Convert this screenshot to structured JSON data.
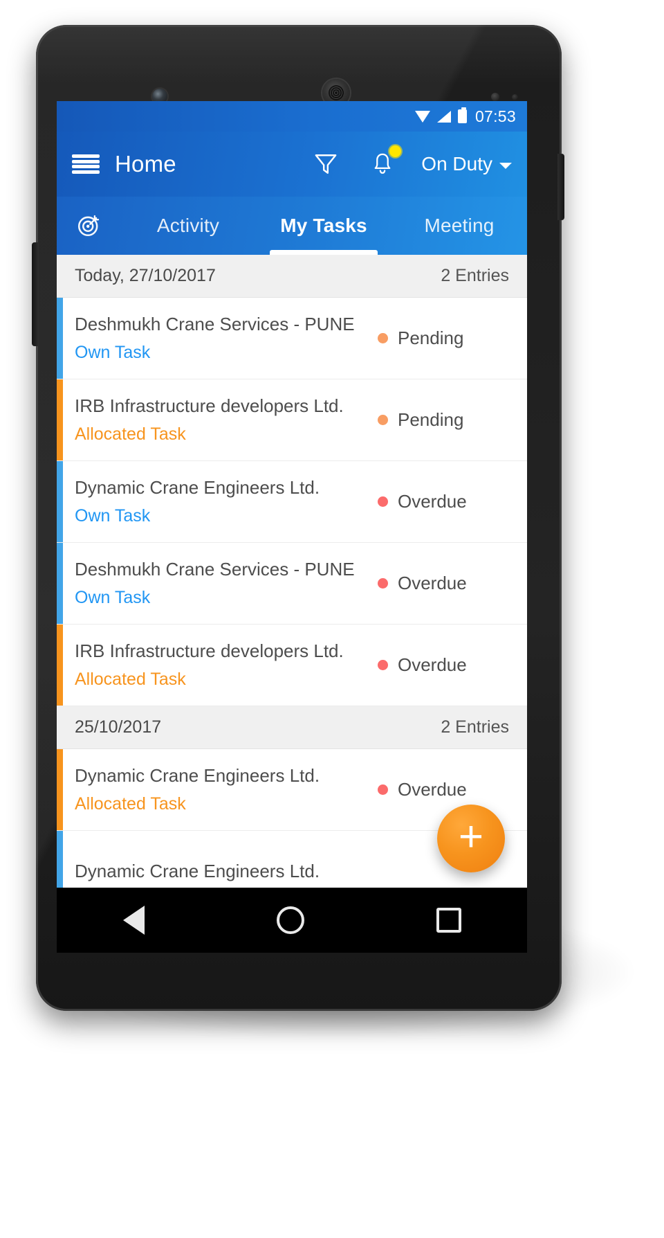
{
  "status_bar": {
    "time": "07:53",
    "wifi_icon": "wifi-icon",
    "signal_icon": "signal-icon",
    "battery_icon": "battery-icon"
  },
  "app_bar": {
    "menu_icon": "hamburger-menu-icon",
    "title": "Home",
    "filter_icon": "filter-funnel-icon",
    "notification_icon": "bell-icon",
    "notification_badge": true,
    "duty_status": "On Duty",
    "duty_caret_icon": "chevron-down-icon"
  },
  "tabs": {
    "leading_icon": "target-icon",
    "items": [
      {
        "label": "Activity",
        "active": false
      },
      {
        "label": "My Tasks",
        "active": true
      },
      {
        "label": "Meeting",
        "active": false
      }
    ]
  },
  "groups": [
    {
      "date_label": "Today, 27/10/2017",
      "entries_label": "2 Entries",
      "rows": [
        {
          "title": "Deshmukh Crane Services - PUNE",
          "type": "Own Task",
          "type_kind": "own",
          "accent": "blue",
          "status": "Pending",
          "status_kind": "pending"
        },
        {
          "title": "IRB Infrastructure developers Ltd.",
          "type": "Allocated Task",
          "type_kind": "allocated",
          "accent": "orange",
          "status": "Pending",
          "status_kind": "pending"
        },
        {
          "title": "Dynamic Crane Engineers Ltd.",
          "type": "Own Task",
          "type_kind": "own",
          "accent": "blue",
          "status": "Overdue",
          "status_kind": "overdue"
        },
        {
          "title": "Deshmukh Crane Services - PUNE",
          "type": "Own Task",
          "type_kind": "own",
          "accent": "blue",
          "status": "Overdue",
          "status_kind": "overdue"
        },
        {
          "title": "IRB Infrastructure developers Ltd.",
          "type": "Allocated Task",
          "type_kind": "allocated",
          "accent": "orange",
          "status": "Overdue",
          "status_kind": "overdue"
        }
      ]
    },
    {
      "date_label": "25/10/2017",
      "entries_label": "2 Entries",
      "rows": [
        {
          "title": "Dynamic Crane Engineers Ltd.",
          "type": "Allocated Task",
          "type_kind": "allocated",
          "accent": "orange",
          "status": "Overdue",
          "status_kind": "overdue"
        },
        {
          "title": "Dynamic Crane Engineers Ltd.",
          "type": "",
          "type_kind": "own",
          "accent": "blue",
          "status": "",
          "status_kind": ""
        }
      ]
    }
  ],
  "fab": {
    "label": "+",
    "icon": "plus-icon"
  },
  "nav_bar": {
    "back_icon": "back-triangle-icon",
    "home_icon": "home-circle-icon",
    "recents_icon": "recents-square-icon"
  },
  "colors": {
    "primary_blue": "#1b72d2",
    "accent_orange": "#f7941e",
    "accent_blue": "#42a5e8",
    "pending": "#f89d63",
    "overdue": "#fb6b6b",
    "badge_yellow": "#ffe600"
  }
}
